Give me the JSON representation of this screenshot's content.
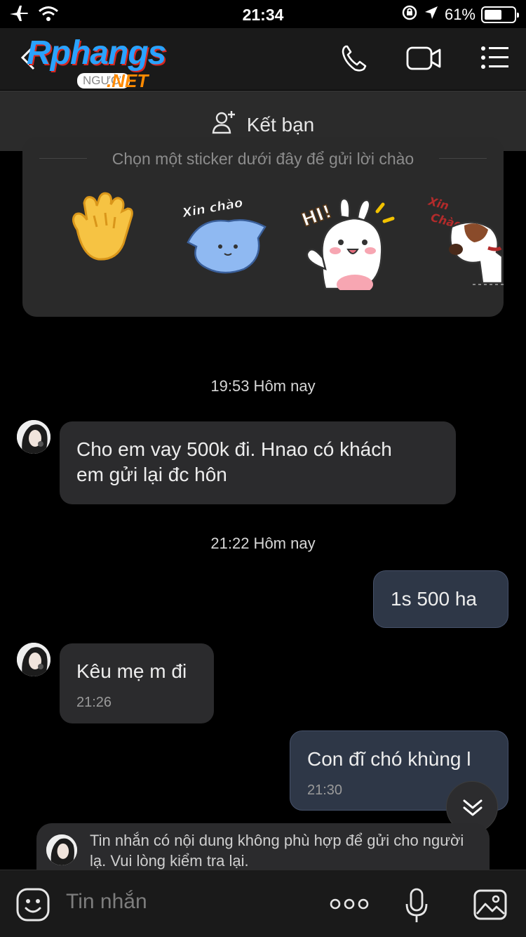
{
  "status": {
    "time": "21:34",
    "battery": "61%",
    "battery_level": 0.61
  },
  "header": {
    "logo_text": "Rphangs",
    "logo_tag": "NGƯỜI",
    "logo_net": ".NET"
  },
  "add_friend": {
    "label": "Kết bạn"
  },
  "sticker_card": {
    "hint": "Chọn một sticker dưới đây để gửi lời chào",
    "stickers": [
      {
        "name": "waving-hand",
        "caption": ""
      },
      {
        "name": "blue-cat",
        "caption": "Xin chào"
      },
      {
        "name": "white-bunny",
        "caption": "HI!"
      },
      {
        "name": "dog",
        "caption": "Xin Chào"
      }
    ]
  },
  "chat": {
    "timestamps": [
      "19:53 Hôm nay",
      "21:22 Hôm nay"
    ],
    "messages": [
      {
        "direction": "in",
        "text": "Cho em vay 500k đi. Hnao có khách em gửi lại đc hôn",
        "line1": "Cho em vay 500k đi. Hnao có khách",
        "line2": "em gửi lại đc hôn",
        "time": ""
      },
      {
        "direction": "out",
        "text": "1s 500 ha",
        "time": ""
      },
      {
        "direction": "in",
        "text": "Kêu mẹ m đi",
        "time": "21:26"
      },
      {
        "direction": "out",
        "text": "Con đĩ chó khùng l",
        "time": "21:30"
      }
    ]
  },
  "warning": {
    "text": "Tin nhắn có nội dung không phù hợp để gửi cho người lạ. Vui lòng kiểm tra lại."
  },
  "input": {
    "placeholder": "Tin nhắn"
  },
  "colors": {
    "background": "#000000",
    "header": "#1a1a1a",
    "incoming_bubble": "#2b2b2d",
    "outgoing_bubble": "#2e3747"
  }
}
